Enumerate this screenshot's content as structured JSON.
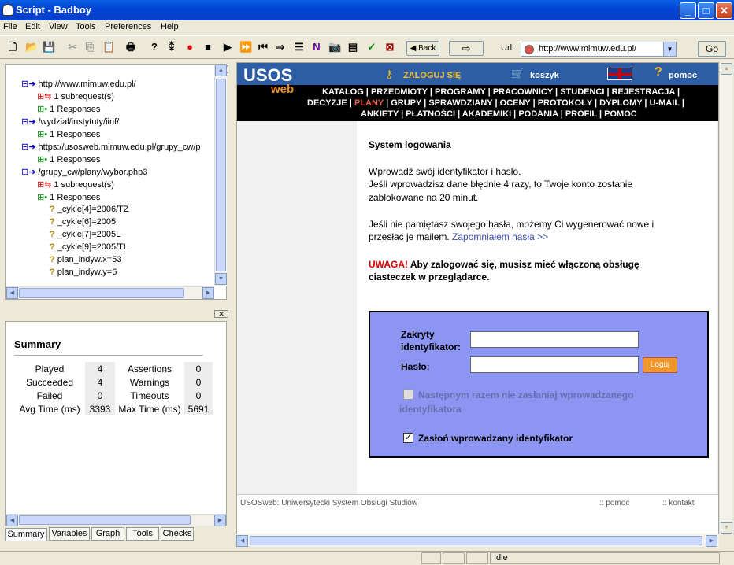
{
  "window": {
    "title": "Script - Badboy"
  },
  "menu": [
    "File",
    "Edit",
    "View",
    "Tools",
    "Preferences",
    "Help"
  ],
  "toolbar": {
    "back": "Back",
    "url_label": "Url:",
    "url": "http://www.mimuw.edu.pl/",
    "go": "Go"
  },
  "tree": {
    "items": [
      {
        "label": "http://www.mimuw.edu.pl/"
      },
      {
        "label": "1 subrequest(s)"
      },
      {
        "label": "1 Responses"
      },
      {
        "label": "/wydzial/instytuty/iinf/"
      },
      {
        "label": "1 Responses"
      },
      {
        "label": "https://usosweb.mimuw.edu.pl/grupy_cw/p"
      },
      {
        "label": "1 Responses"
      },
      {
        "label": "/grupy_cw/plany/wybor.php3"
      },
      {
        "label": "1 subrequest(s)"
      },
      {
        "label": "1 Responses"
      },
      {
        "label": "_cykle[4]=2006/TZ"
      },
      {
        "label": "_cykle[6]=2005"
      },
      {
        "label": "_cykle[7]=2005L"
      },
      {
        "label": "_cykle[9]=2005/TL"
      },
      {
        "label": "plan_indyw.x=53"
      },
      {
        "label": "plan_indyw.y=6"
      }
    ]
  },
  "summary": {
    "title": "Summary",
    "rows": [
      {
        "l1": "Played",
        "v1": "4",
        "l2": "Assertions",
        "v2": "0"
      },
      {
        "l1": "Succeeded",
        "v1": "4",
        "l2": "Warnings",
        "v2": "0"
      },
      {
        "l1": "Failed",
        "v1": "0",
        "l2": "Timeouts",
        "v2": "0"
      },
      {
        "l1": "Avg Time (ms)",
        "v1": "3393",
        "l2": "Max Time (ms)",
        "v2": "5691"
      }
    ]
  },
  "tabs": [
    "Summary",
    "Variables",
    "Graph",
    "Tools",
    "Checks"
  ],
  "usos": {
    "logo1": "USOS",
    "logo2": "web",
    "login": "ZALOGUJ SIĘ",
    "cart": "koszyk",
    "help": "pomoc",
    "nav1": "KATALOG | PRZEDMIOTY | PROGRAMY | PRACOWNICY | STUDENCI | REJESTRACJA |",
    "nav2a": "DECYZJE |",
    "nav2cur": "PLANY",
    "nav2b": "| GRUPY | SPRAWDZIANY | OCENY | PROTOKOŁY | DYPLOMY | U-MAIL |",
    "nav3": "ANKIETY | PŁATNOŚCI | AKADEMIKI | PODANIA | PROFIL | POMOC",
    "heading": "System logowania",
    "p1a": "Wprowadź swój identyfikator i hasło.",
    "p1b": "Jeśli wprowadzisz dane błędnie 4 razy, to Twoje konto zostanie",
    "p1c": "zablokowane na 20 minut.",
    "p2a": "Jeśli nie pamiętasz swojego hasła, możemy Ci wygenerować nowe i",
    "p2b": "przesłać je mailem.",
    "forgot": "Zapomniałem hasła >>",
    "warn": "UWAGA!",
    "warn1": "Aby zalogować się, musisz mieć włączoną obsługę",
    "warn2": "ciasteczek w przeglądarce.",
    "id_label1": "Zakryty",
    "id_label2": "identyfikator:",
    "pass_label": "Hasło:",
    "login_btn": "Loguj",
    "chk1a": "Następnym razem nie zasłaniaj wprowadzanego",
    "chk1b": "identyfikatora",
    "chk2": "Zasłoń wprowadzany identyfikator",
    "footer": "USOSweb: Uniwersytecki System Obsługi Studiów",
    "f_help": ":: pomoc",
    "f_contact": ":: kontakt"
  },
  "status": {
    "text": "Idle"
  }
}
